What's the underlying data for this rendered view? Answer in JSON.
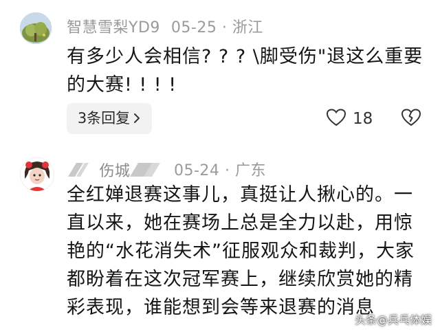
{
  "comments": [
    {
      "username": "智慧雪梨YD9",
      "date": "05-25",
      "location": "浙江",
      "separator": "·",
      "content": "有多少人会相信? ? ?  \\脚受伤\"退这么重要的大赛! ! ! !",
      "replies_label": "3条回复",
      "likes": "18"
    },
    {
      "username": "伤城",
      "date": "05-24",
      "location": "广东",
      "separator": "·",
      "content": "全红婵退赛这事儿，真挺让人揪心的。一直以来，她在赛场上总是全力以赴，用惊艳的“水花消失术”征服观众和裁判，大家都盼着在这次冠军赛上，继续欣赏她的精彩表现，谁能想到会等来退赛的消息"
    }
  ],
  "watermark": "头条@兵乓体娱",
  "icons": {
    "like": "heart-outline-icon",
    "dislike": "broken-heart-icon",
    "chevron": "chevron-right-icon"
  },
  "colors": {
    "meta_text": "#9a9a9a",
    "body_text": "#151515",
    "pill_bg": "#f2f2f2"
  }
}
